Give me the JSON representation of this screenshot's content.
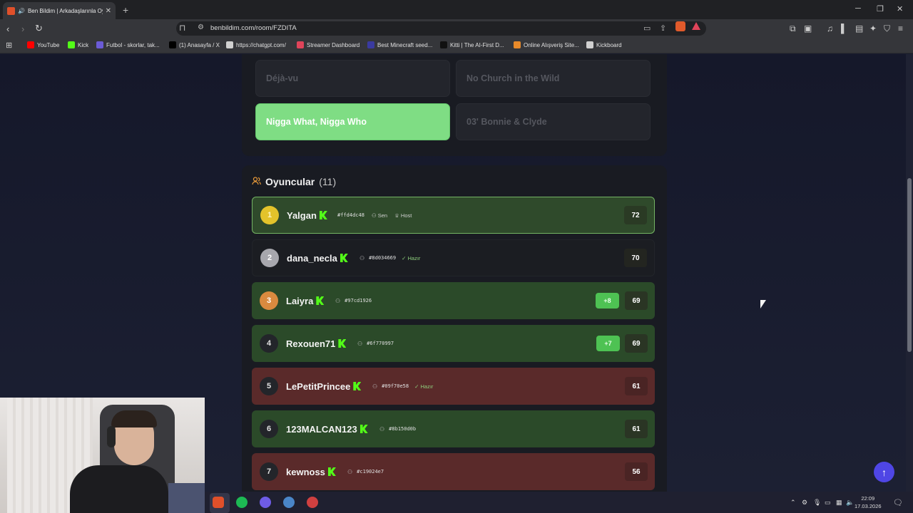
{
  "browser": {
    "tab_title": "Ben Bildim | Arkadaşlarınla Oy",
    "url": "benbildim.com/room/FZDITA",
    "bookmarks": [
      {
        "label": "YouTube",
        "color": "#ff0000"
      },
      {
        "label": "Kick",
        "color": "#53fc18"
      },
      {
        "label": "Futbol - skorlar, tak...",
        "color": "#6b5bd6"
      },
      {
        "label": "(1) Anasayfa / X",
        "color": "#000000"
      },
      {
        "label": "https://chatgpt.com/",
        "color": "#d0d0d0"
      },
      {
        "label": "Streamer Dashboard",
        "color": "#e0445a"
      },
      {
        "label": "Best Minecraft seed...",
        "color": "#3a3aa0"
      },
      {
        "label": "Kitti | The AI-First D...",
        "color": "#111111"
      },
      {
        "label": "Online Alışveriş Site...",
        "color": "#e88a2a"
      },
      {
        "label": "Kickboard",
        "color": "#d0d0d0"
      }
    ]
  },
  "answers": [
    {
      "label": "Déjà-vu",
      "state": "dim"
    },
    {
      "label": "No Church in the Wild",
      "state": "dim"
    },
    {
      "label": "Nigga What, Nigga Who",
      "state": "correct"
    },
    {
      "label": "03' Bonnie & Clyde",
      "state": "dim"
    }
  ],
  "players_section": {
    "title": "Oyuncular",
    "count": "(11)"
  },
  "players": [
    {
      "rank": "1",
      "name": "Yalgan",
      "hash": "#ffd4dc48",
      "you": "Sen",
      "host": "Host",
      "ready": "",
      "delta": "",
      "score": "72"
    },
    {
      "rank": "2",
      "name": "dana_necla",
      "hash": "#8d034669",
      "you": "",
      "host": "",
      "ready": "Hazır",
      "delta": "",
      "score": "70"
    },
    {
      "rank": "3",
      "name": "Laiyra",
      "hash": "#97cd1926",
      "you": "",
      "host": "",
      "ready": "",
      "delta": "+8",
      "score": "69"
    },
    {
      "rank": "4",
      "name": "Rexouen71",
      "hash": "#6f770997",
      "you": "",
      "host": "",
      "ready": "",
      "delta": "+7",
      "score": "69"
    },
    {
      "rank": "5",
      "name": "LePetitPrincee",
      "hash": "#09f70e58",
      "you": "",
      "host": "",
      "ready": "Hazır",
      "delta": "",
      "score": "61"
    },
    {
      "rank": "6",
      "name": "123MALCAN123",
      "hash": "#8b150d0b",
      "you": "",
      "host": "",
      "ready": "",
      "delta": "",
      "score": "61"
    },
    {
      "rank": "7",
      "name": "kewnoss",
      "hash": "#c19024e7",
      "you": "",
      "host": "",
      "ready": "",
      "delta": "",
      "score": "56"
    }
  ],
  "system": {
    "time": "22:09",
    "date": "17.03.2026"
  }
}
